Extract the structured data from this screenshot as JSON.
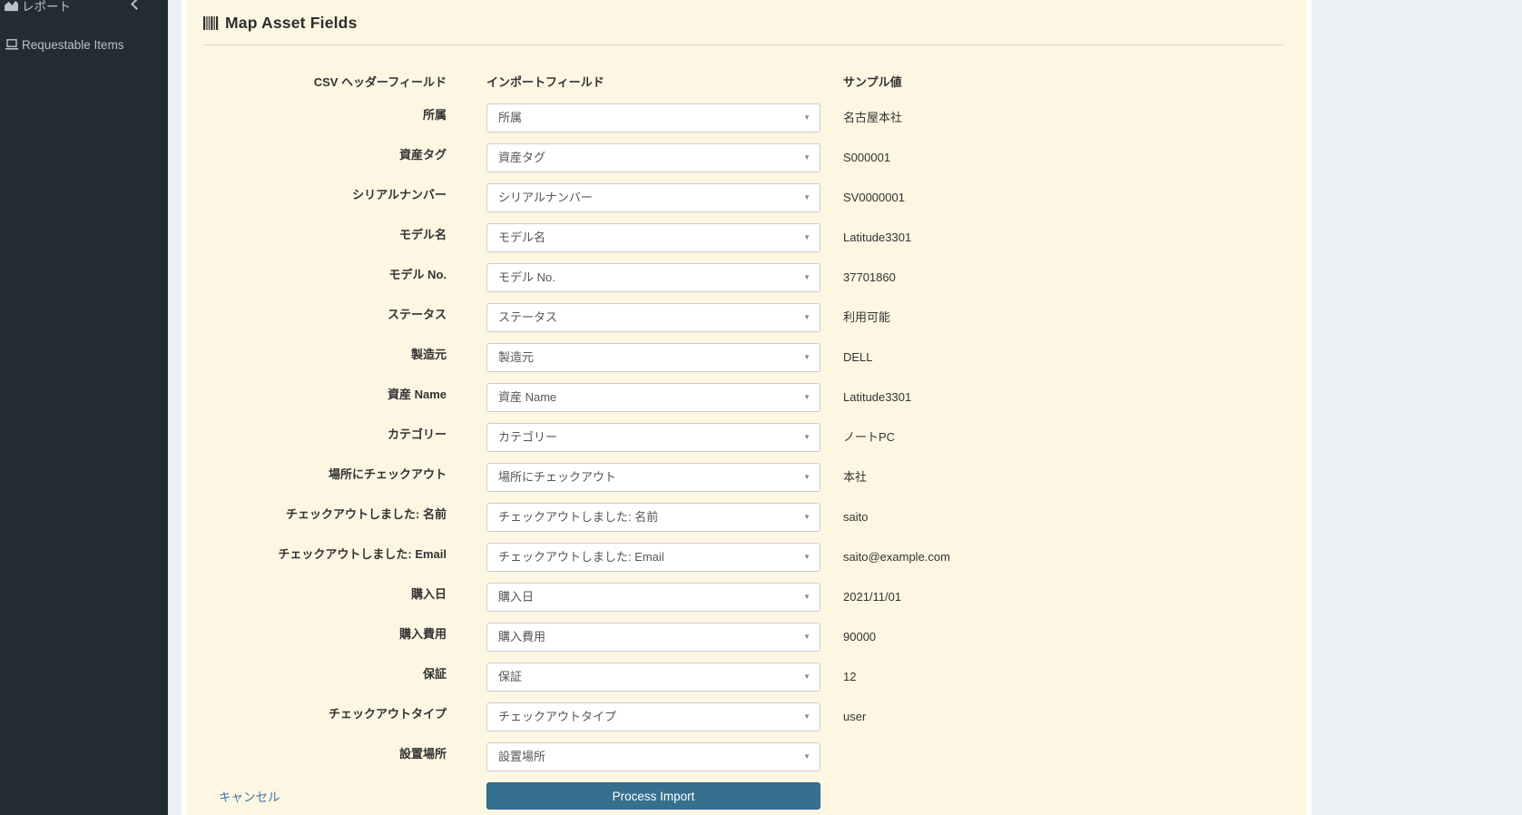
{
  "sidebar": {
    "items": [
      {
        "label": "レポート",
        "icon": "area-chart-icon",
        "has_submenu": true
      },
      {
        "label": "Requestable Items",
        "icon": "laptop-icon"
      }
    ]
  },
  "panel": {
    "icon": "barcode-icon",
    "title": "Map Asset Fields"
  },
  "form": {
    "headers": {
      "csv": "CSV ヘッダーフィールド",
      "import": "インポートフィールド",
      "sample": "サンプル値"
    },
    "rows": [
      {
        "csv": "所属",
        "import": "所属",
        "sample": "名古屋本社"
      },
      {
        "csv": "資産タグ",
        "import": "資産タグ",
        "sample": "S000001"
      },
      {
        "csv": "シリアルナンバー",
        "import": "シリアルナンバー",
        "sample": "SV0000001"
      },
      {
        "csv": "モデル名",
        "import": "モデル名",
        "sample": "Latitude3301"
      },
      {
        "csv": "モデル No.",
        "import": "モデル No.",
        "sample": "37701860"
      },
      {
        "csv": "ステータス",
        "import": "ステータス",
        "sample": "利用可能"
      },
      {
        "csv": "製造元",
        "import": "製造元",
        "sample": "DELL"
      },
      {
        "csv": "資産 Name",
        "import": "資産 Name",
        "sample": "Latitude3301"
      },
      {
        "csv": "カテゴリー",
        "import": "カテゴリー",
        "sample": "ノートPC"
      },
      {
        "csv": "場所にチェックアウト",
        "import": "場所にチェックアウト",
        "sample": "本社"
      },
      {
        "csv": "チェックアウトしました: 名前",
        "import": "チェックアウトしました: 名前",
        "sample": "saito"
      },
      {
        "csv": "チェックアウトしました: Email",
        "import": "チェックアウトしました: Email",
        "sample": "saito@example.com"
      },
      {
        "csv": "購入日",
        "import": "購入日",
        "sample": "2021/11/01"
      },
      {
        "csv": "購入費用",
        "import": "購入費用",
        "sample": "90000"
      },
      {
        "csv": "保証",
        "import": "保証",
        "sample": "12"
      },
      {
        "csv": "チェックアウトタイプ",
        "import": "チェックアウトタイプ",
        "sample": "user"
      },
      {
        "csv": "設置場所",
        "import": "設置場所",
        "sample": ""
      }
    ],
    "cancel_label": "キャンセル",
    "submit_label": "Process Import"
  },
  "colors": {
    "sidebar_bg": "#222d32",
    "sidebar_text": "#b8c2cc",
    "page_bg": "#ecf0f5",
    "panel_bg": "#fdf6e3",
    "button_bg": "#35708f",
    "link": "#3f78a5"
  }
}
